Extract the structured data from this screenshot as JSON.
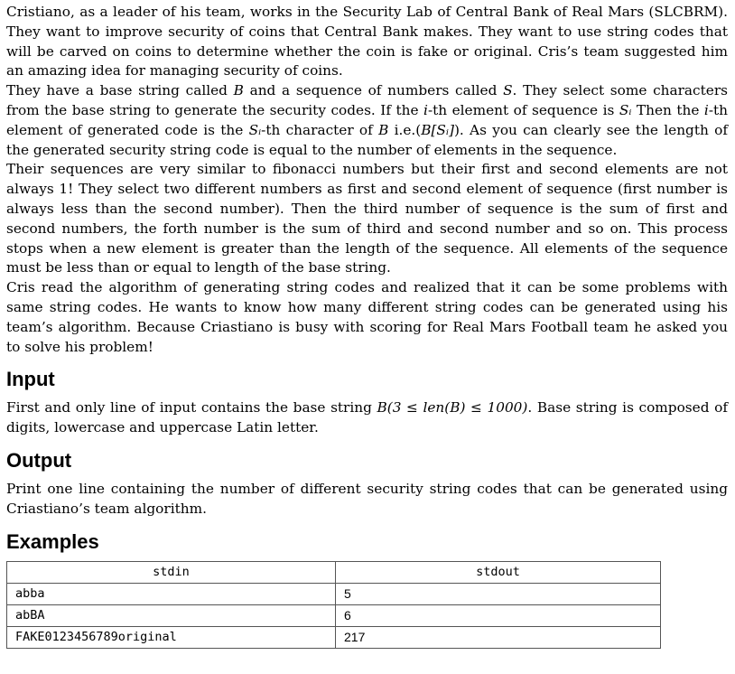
{
  "statement": {
    "p1": "Cristiano, as a leader of his team, works in the Security Lab of Central Bank of Real Mars (SLCBRM). They want to improve security of coins that Central Bank makes. They want to use string codes that will be carved on coins to determine whether the coin is fake or original. Cris’s team suggested him an amazing idea for managing security of coins.",
    "p2": {
      "a": "They have a base string called ",
      "b_var": "B",
      "c": " and a sequence of numbers called ",
      "s_var": "S",
      "d": ". They select some characters from the base string to generate the security codes. If the ",
      "i_var1": "i",
      "e": "-th element of sequence is ",
      "si_var1": "Sᵢ",
      "f": " Then the ",
      "i_var2": "i",
      "g": "-th element of generated code is the ",
      "si_var2": "Sᵢ",
      "h": "-th character of ",
      "b_var2": "B",
      "j": " i.e.(",
      "bsi_var": "B[Sᵢ]",
      "k": "). As you can clearly see the length of the generated security string code is equal to the number of elements in the sequence."
    },
    "p3": "Their sequences are very similar to fibonacci numbers but their first and second elements are not always 1! They select two different numbers as first and second element of sequence (first number is always less than the second number). Then the third number of sequence is the sum of first and second numbers, the forth number is the sum of third and second number and so on. This process stops when a new element is greater than the length of the sequence. All elements of the sequence must be less than or equal to length of the base string.",
    "p4": "Cris read the algorithm of generating string codes and realized that it can be some problems with same string codes. He wants to know how many different string codes can be generated using his team’s algorithm. Because Criastiano is busy with scoring for Real Mars Football team he asked you to solve his problem!"
  },
  "input": {
    "heading": "Input",
    "a": "First and only line of input contains the base string ",
    "math": "B(3 ≤ len(B) ≤ 1000)",
    "b": ". Base string is composed of digits, lowercase and uppercase Latin letter."
  },
  "output": {
    "heading": "Output",
    "text": "Print one line containing the number of different security string codes that can be generated using Criastiano’s team algorithm."
  },
  "examples": {
    "heading": "Examples",
    "columns": [
      "stdin",
      "stdout"
    ],
    "rows": [
      {
        "stdin": "abba",
        "stdout": "5"
      },
      {
        "stdin": "abBA",
        "stdout": "6"
      },
      {
        "stdin": "FAKE0123456789original",
        "stdout": "217"
      }
    ]
  }
}
